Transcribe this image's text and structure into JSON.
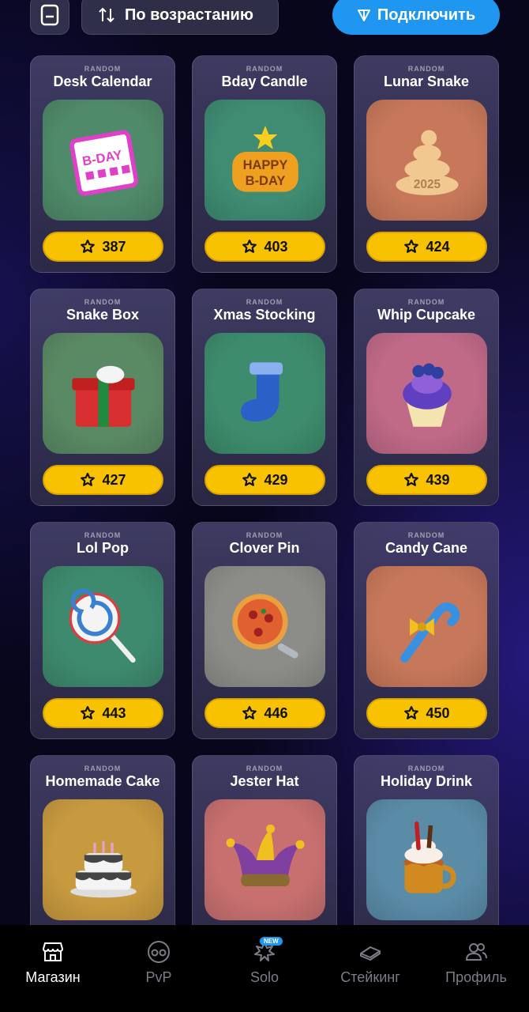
{
  "topbar": {
    "sort_label": "По возрастанию",
    "connect_label": "Подключить"
  },
  "cards": [
    {
      "tag": "RANDOM",
      "title": "Desk Calendar",
      "price": "387",
      "bg": "#4f8a6a",
      "icon": "calendar-icon",
      "accent": "#e040c8"
    },
    {
      "tag": "RANDOM",
      "title": "Bday Candle",
      "price": "403",
      "bg": "#3f8c72",
      "icon": "candle-icon",
      "accent": "#f0a020"
    },
    {
      "tag": "RANDOM",
      "title": "Lunar Snake",
      "price": "424",
      "bg": "#c8785a",
      "icon": "snake-icon",
      "accent": "#f0c890"
    },
    {
      "tag": "RANDOM",
      "title": "Snake Box",
      "price": "427",
      "bg": "#5a8a64",
      "icon": "gift-box-icon",
      "accent": "#d83030"
    },
    {
      "tag": "RANDOM",
      "title": "Xmas Stocking",
      "price": "429",
      "bg": "#3e8c6e",
      "icon": "stocking-icon",
      "accent": "#2a60c8"
    },
    {
      "tag": "RANDOM",
      "title": "Whip Cupcake",
      "price": "439",
      "bg": "#c06a88",
      "icon": "cupcake-icon",
      "accent": "#6040c0"
    },
    {
      "tag": "RANDOM",
      "title": "Lol Pop",
      "price": "443",
      "bg": "#3e8a6e",
      "icon": "lollipop-icon",
      "accent": "#d84040"
    },
    {
      "tag": "RANDOM",
      "title": "Clover Pin",
      "price": "446",
      "bg": "#8c8c88",
      "icon": "pizza-icon",
      "accent": "#e06030"
    },
    {
      "tag": "RANDOM",
      "title": "Candy Cane",
      "price": "450",
      "bg": "#c8785a",
      "icon": "candy-cane-icon",
      "accent": "#3a90e0"
    },
    {
      "tag": "RANDOM",
      "title": "Homemade Cake",
      "price": "",
      "bg": "#c89a40",
      "icon": "cake-icon",
      "accent": "#444"
    },
    {
      "tag": "RANDOM",
      "title": "Jester Hat",
      "price": "",
      "bg": "#c87070",
      "icon": "jester-hat-icon",
      "accent": "#8040a0"
    },
    {
      "tag": "RANDOM",
      "title": "Holiday Drink",
      "price": "",
      "bg": "#5a8ca8",
      "icon": "drink-icon",
      "accent": "#c06020"
    }
  ],
  "nav": [
    {
      "label": "Магазин",
      "icon": "store-icon",
      "active": true
    },
    {
      "label": "PvP",
      "icon": "pvp-icon",
      "active": false
    },
    {
      "label": "Solo",
      "icon": "solo-icon",
      "active": false,
      "badge": "NEW"
    },
    {
      "label": "Стейкинг",
      "icon": "staking-icon",
      "active": false
    },
    {
      "label": "Профиль",
      "icon": "profile-icon",
      "active": false
    }
  ],
  "colors": {
    "price_bg": "#f9c200",
    "connect_bg": "#1f96f0",
    "nav_bg": "#000000"
  }
}
